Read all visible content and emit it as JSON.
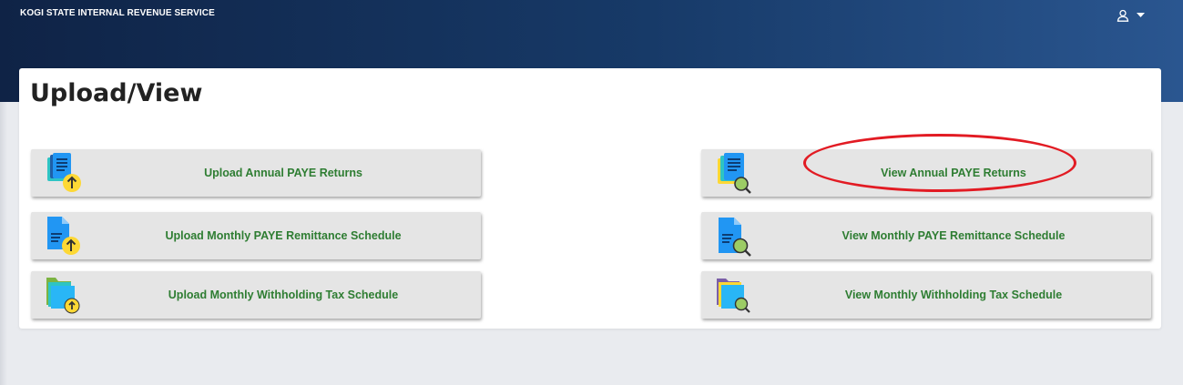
{
  "header": {
    "brand": "KOGI STATE INTERNAL REVENUE SERVICE",
    "user_icon": "user-icon",
    "caret_icon": "caret-down-icon",
    "background_start": "#0f2346",
    "background_end": "#2a5690"
  },
  "page": {
    "title": "Upload/View"
  },
  "tiles": [
    {
      "label": "Upload Annual PAYE Returns",
      "icon": "upload-document-icon"
    },
    {
      "label": "View Annual PAYE Returns",
      "icon": "view-document-icon"
    },
    {
      "label": "Upload Monthly PAYE Remittance Schedule",
      "icon": "upload-file-icon"
    },
    {
      "label": "View Monthly PAYE Remittance Schedule",
      "icon": "view-file-icon"
    },
    {
      "label": "Upload Monthly Withholding Tax Schedule",
      "icon": "upload-folder-icon"
    },
    {
      "label": "View Monthly Withholding Tax Schedule",
      "icon": "view-folder-icon"
    }
  ],
  "colors": {
    "label_green": "#2e7d32",
    "tile_bg": "#e5e5e5",
    "highlight_red": "#e21b23"
  }
}
